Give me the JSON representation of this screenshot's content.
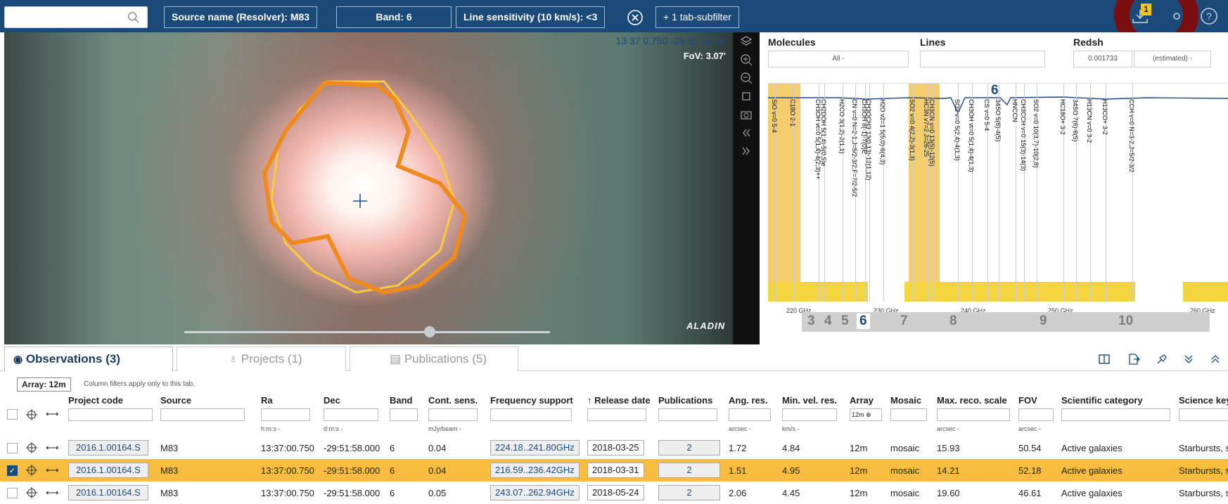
{
  "topbar": {
    "search_placeholder": "",
    "chips": [
      "Source name (Resolver): M83",
      "Band: 6",
      "Line sensitivity (10 km/s): <3",
      "+ 1 tab-subfilter"
    ],
    "badge_count": "1",
    "accent_color": "#1c4a78",
    "highlight_ring_color": "#7a0d10"
  },
  "sky": {
    "coordinates": "13 37 0.750 -29 51 58.00",
    "fov": "FoV: 3.07'",
    "logo_text": "ALADIN"
  },
  "spectral": {
    "molecules_label": "Molecules",
    "molecules_value": "All -",
    "lines_label": "Lines",
    "redshift_label": "Redsh",
    "redshift_value": "0.001733",
    "redshift_mode": "(estimated) -",
    "active_band_label": "6",
    "freq_ticks": [
      "220 GHz",
      "230 GHz",
      "240 GHz",
      "250 GHz",
      "260 GHz"
    ],
    "band_numbers": [
      "3",
      "4",
      "5",
      "6",
      "7",
      "8",
      "9",
      "10"
    ],
    "line_labels": [
      "SiO v=0 5-4",
      "C18O 2-1",
      "CH3OH vt=0 5(1,4)-4(2,3)++",
      "CH2DOH 5(1,4)-5(0,5)e",
      "H2CO 3(1,2)-2(1,1)",
      "CN v=0 N=2-1,J=5/2-3/2,F=7/2-5/2",
      "CH3OH 8(-1)-7(0)E",
      "CH3OCH3 13(0,13)-12(1,12)",
      "H2O v2=1 5(5,0)-6(4,3)",
      "SO2 v=0 4(2,2)-3(1,3)",
      "HC3N v7=2 J=26-25",
      "CH3CN v=0 13(5)-12(5)",
      "SO2 v=0 5(2,4)-4(1,3)",
      "CH3OH vt=0 5(1,4)-4(1,3)",
      "CS v=0 5-4",
      "34SO 5(6)-4(5)",
      "HNCCN",
      "CH3CCH v=0 15(3)-14(3)",
      "SO2 v=0 10(3,7)-10(2,8)",
      "HC18O+ 3-2",
      "34SO 7(6)-6(5)",
      "H13CN v=0 3-2",
      "H13CO+ 3-2",
      "CCH v=0 N=3-2,J=5/2-3/2"
    ]
  },
  "tabs": [
    {
      "label": "Observations (3)",
      "active": true
    },
    {
      "label": "Projects (1)",
      "active": false
    },
    {
      "label": "Publications (5)",
      "active": false
    }
  ],
  "filters": {
    "array_chip": "Array: 12m",
    "column_note": "Column filters apply only to this tab.",
    "array_filter_value": "12m"
  },
  "table": {
    "columns": [
      "Project code",
      "Source",
      "Ra",
      "Dec",
      "Band",
      "Cont. sens.",
      "Frequency support",
      "↑ Release date",
      "Publications",
      "Ang. res.",
      "Min. vel. res.",
      "Array",
      "Mosaic",
      "Max. reco. scale",
      "FOV",
      "Scientific category",
      "Science keyw"
    ],
    "units": {
      "ra": "h:m:s -",
      "dec": "d:m:s -",
      "cont": "mJy/beam -",
      "ang": "arcsec -",
      "vel": "km/s -",
      "maxreco": "arcsec -",
      "fov": "arcsec -"
    },
    "rows": [
      {
        "project": "2016.1.00164.S",
        "source": "M83",
        "ra": "13:37:00.750",
        "dec": "-29:51:58.000",
        "band": "6",
        "cont": "0.04",
        "freq": "224.18..241.80GHz",
        "release": "2018-03-25",
        "pubs": "2",
        "ang": "1.72",
        "vel": "4.84",
        "array": "12m",
        "mosaic": "mosaic",
        "maxreco": "15.93",
        "fov": "50.54",
        "category": "Active galaxies",
        "keyw": "Starbursts, s",
        "selected": false
      },
      {
        "project": "2016.1.00164.S",
        "source": "M83",
        "ra": "13:37:00.750",
        "dec": "-29:51:58.000",
        "band": "6",
        "cont": "0.04",
        "freq": "216.59..236.42GHz",
        "release": "2018-03-31",
        "pubs": "2",
        "ang": "1.51",
        "vel": "4.95",
        "array": "12m",
        "mosaic": "mosaic",
        "maxreco": "14.21",
        "fov": "52.18",
        "category": "Active galaxies",
        "keyw": "Starbursts, s",
        "selected": true
      },
      {
        "project": "2016.1.00164.S",
        "source": "M83",
        "ra": "13:37:00.750",
        "dec": "-29:51:58.000",
        "band": "6",
        "cont": "0.05",
        "freq": "243.07..262.94GHz",
        "release": "2018-05-24",
        "pubs": "2",
        "ang": "2.06",
        "vel": "4.45",
        "array": "12m",
        "mosaic": "mosaic",
        "maxreco": "19.60",
        "fov": "46.61",
        "category": "Active galaxies",
        "keyw": "Starbursts, s",
        "selected": false
      }
    ]
  }
}
